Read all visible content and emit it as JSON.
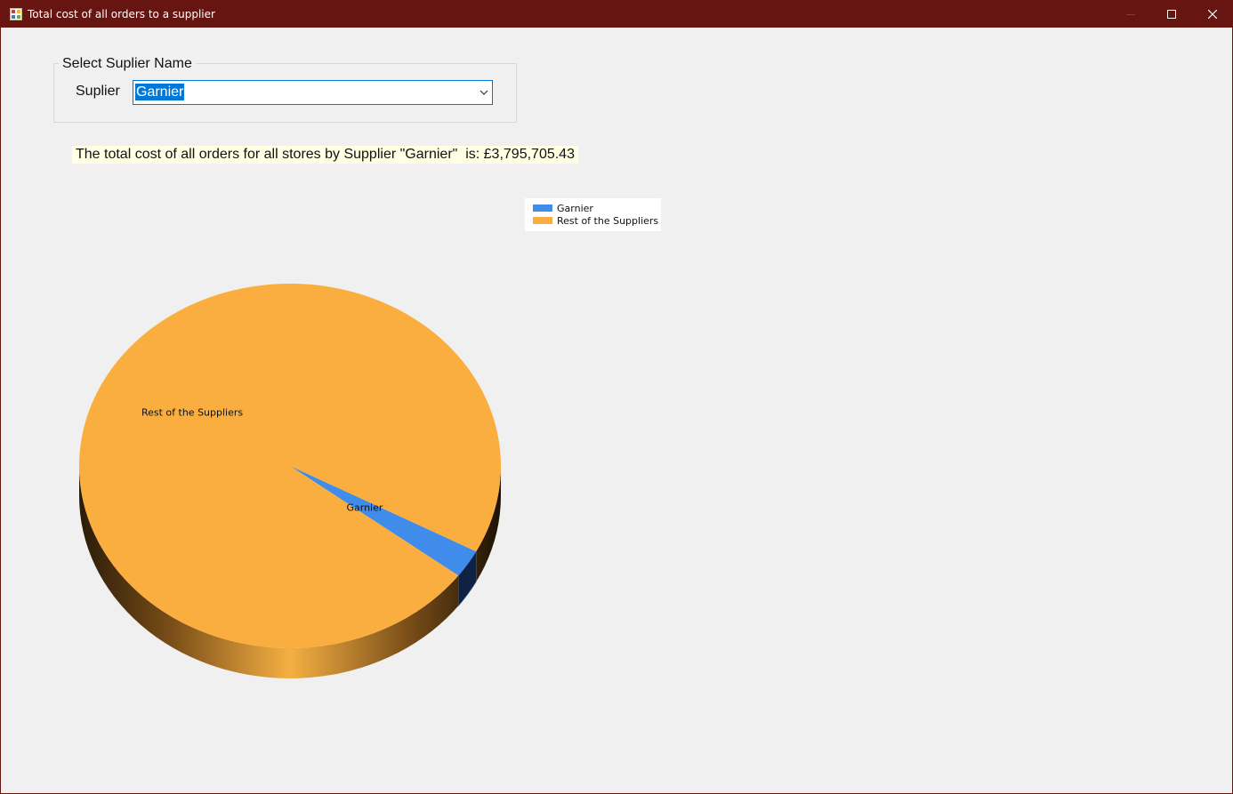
{
  "window": {
    "title": "Total cost of all orders to a supplier",
    "titlebar_color": "#661510",
    "controls": {
      "minimize": "minimize-icon",
      "maximize": "maximize-icon",
      "close": "close-icon"
    }
  },
  "group": {
    "legend": "Select Suplier Name",
    "supplier_label": "Suplier",
    "supplier_value": "Garnier"
  },
  "summary": {
    "text": "The total cost of all orders for all stores by Supplier \"Garnier\"  is: £3,795,705.43"
  },
  "chart_data": {
    "type": "pie",
    "style": "3d",
    "legend_position": "top-right",
    "series": [
      {
        "name": "Garnier",
        "value": 2.5,
        "color": "#3f8cea"
      },
      {
        "name": "Rest of the Suppliers",
        "value": 97.5,
        "color": "#faae3f"
      }
    ],
    "slice_labels": [
      "Garnier",
      "Rest of the Suppliers"
    ]
  }
}
